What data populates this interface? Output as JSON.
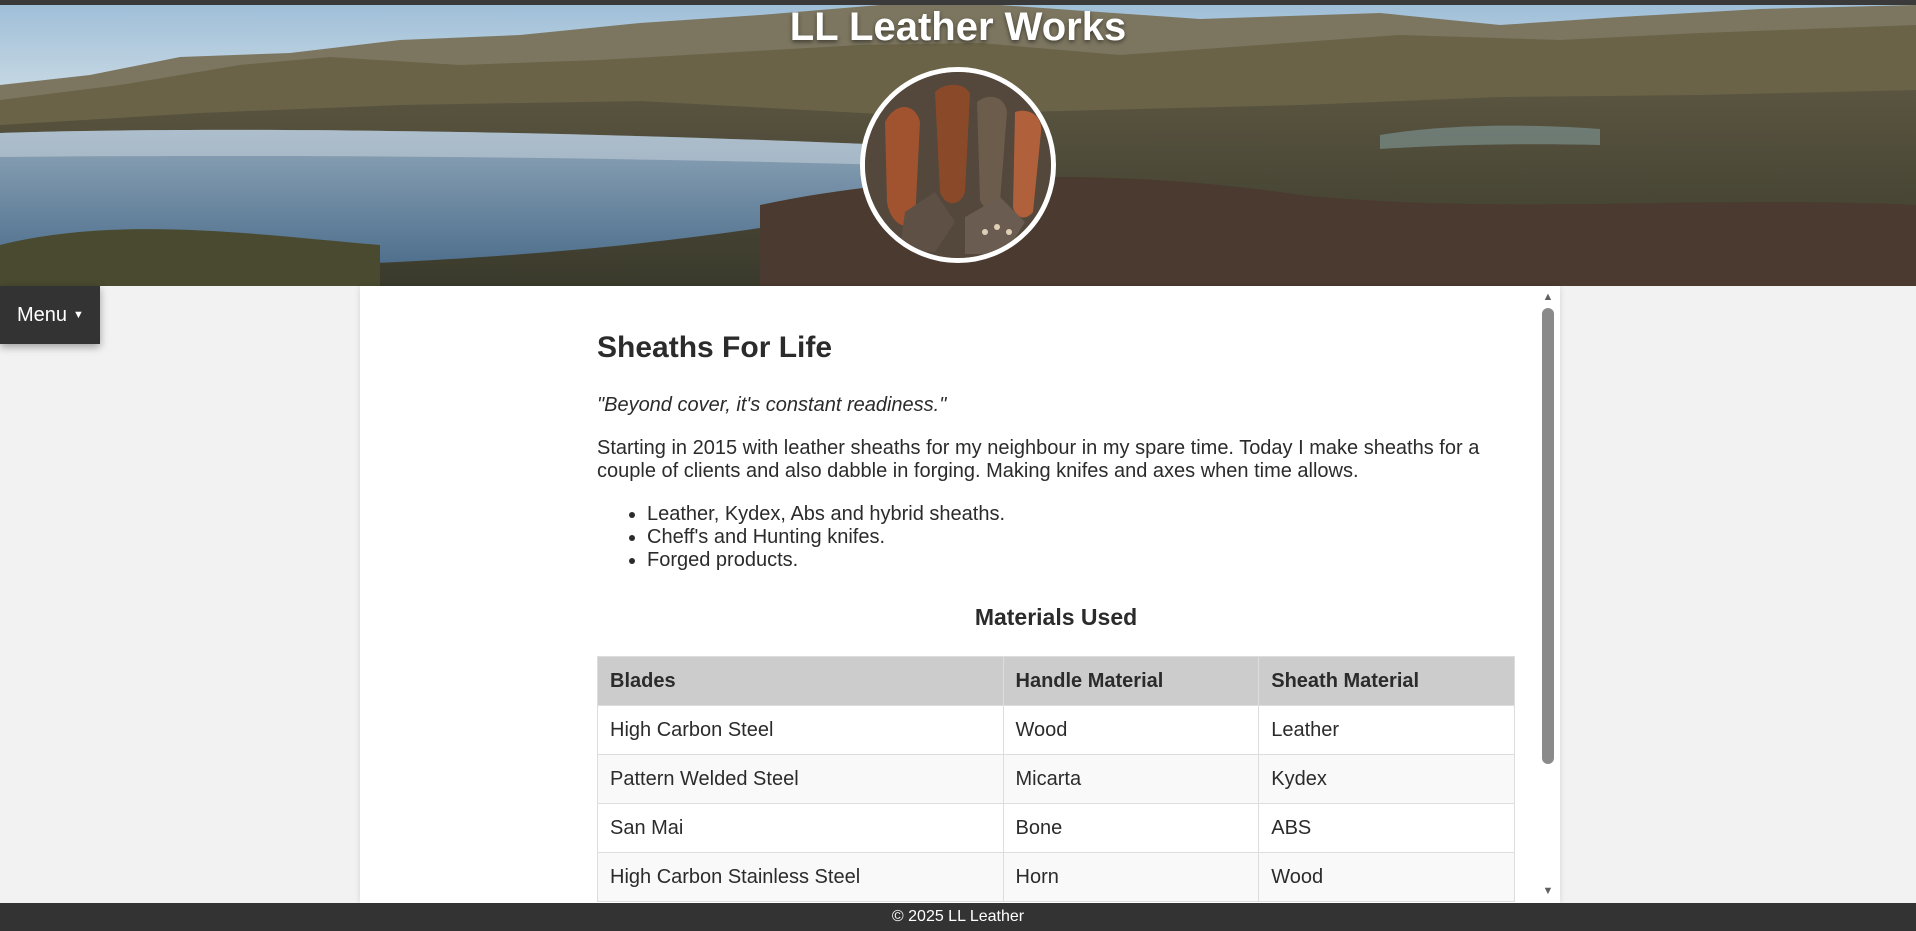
{
  "site": {
    "title": "LL Leather Works"
  },
  "nav": {
    "menu_label": "Menu",
    "menu_caret": "▼"
  },
  "main": {
    "heading": "Sheaths For Life",
    "tagline": "\"Beyond cover, it's constant readiness.\"",
    "intro": "Starting in 2015 with leather sheaths for my neighbour in my spare time. Today I make sheaths for a couple of clients and also dabble in forging. Making knifes and axes when time allows.",
    "features": [
      "Leather, Kydex, Abs and hybrid sheaths.",
      "Cheff's and Hunting knifes.",
      "Forged products."
    ],
    "materials": {
      "title": "Materials Used",
      "headers": [
        "Blades",
        "Handle Material",
        "Sheath Material"
      ],
      "rows": [
        [
          "High Carbon Steel",
          "Wood",
          "Leather"
        ],
        [
          "Pattern Welded Steel",
          "Micarta",
          "Kydex"
        ],
        [
          "San Mai",
          "Bone",
          "ABS"
        ],
        [
          "High Carbon Stainless Steel",
          "Horn",
          "Wood"
        ]
      ]
    }
  },
  "scroll": {
    "up_glyph": "▲",
    "down_glyph": "▼"
  },
  "footer": {
    "text": "© 2025 LL Leather"
  },
  "colors": {
    "dark_bar": "#333333",
    "table_header": "#cccccc",
    "page_bg": "#f2f2f2"
  }
}
